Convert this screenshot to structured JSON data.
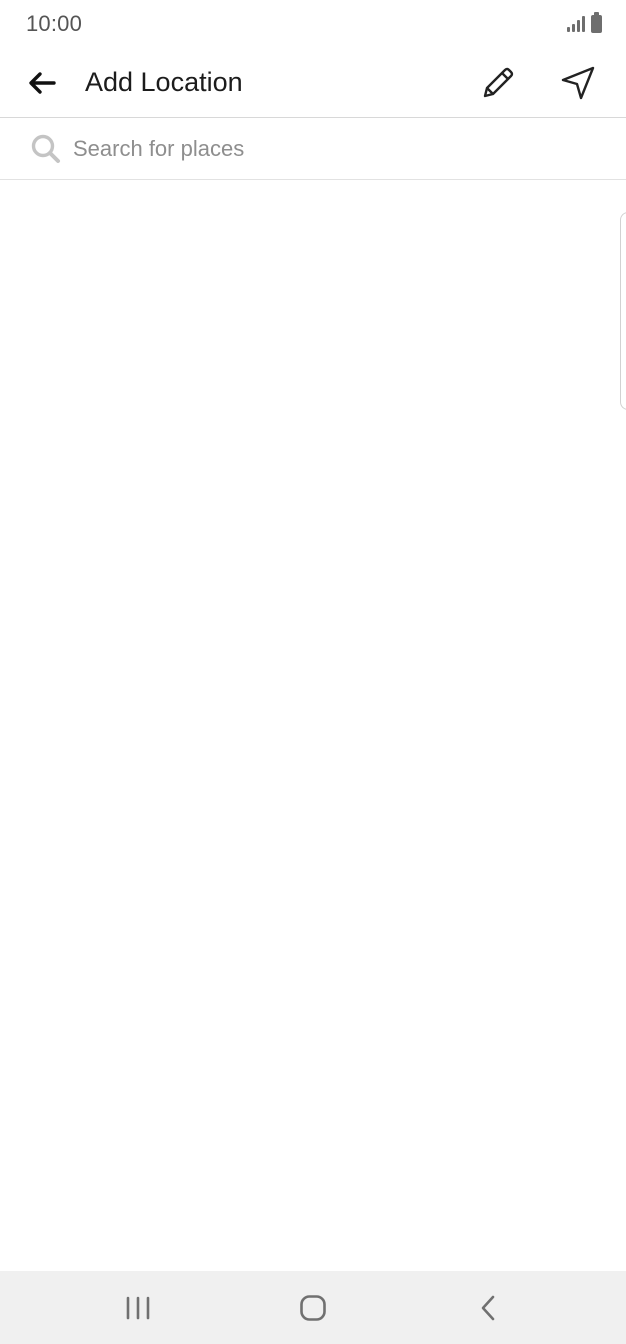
{
  "status_bar": {
    "time": "10:00",
    "icons": [
      "signal-icon",
      "battery-icon"
    ]
  },
  "app_bar": {
    "title": "Add Location",
    "back_icon": "arrow-left-icon",
    "actions": [
      {
        "name": "edit-button",
        "icon": "pencil-icon"
      },
      {
        "name": "current-location-button",
        "icon": "navigation-arrow-icon"
      }
    ]
  },
  "search": {
    "icon": "search-icon",
    "value": "",
    "placeholder": "Search for places"
  },
  "nav_bar": {
    "buttons": [
      {
        "name": "recent-apps-button",
        "icon": "recent-apps-icon"
      },
      {
        "name": "home-button",
        "icon": "home-icon"
      },
      {
        "name": "back-nav-button",
        "icon": "chevron-left-icon"
      }
    ]
  },
  "colors": {
    "background": "#ffffff",
    "text_primary": "#1c1c1c",
    "placeholder": "#8e8e8e",
    "divider": "#d8d8d8",
    "nav_bar_bg": "#f0f0f0",
    "icon_gray": "#6e6e6e"
  }
}
